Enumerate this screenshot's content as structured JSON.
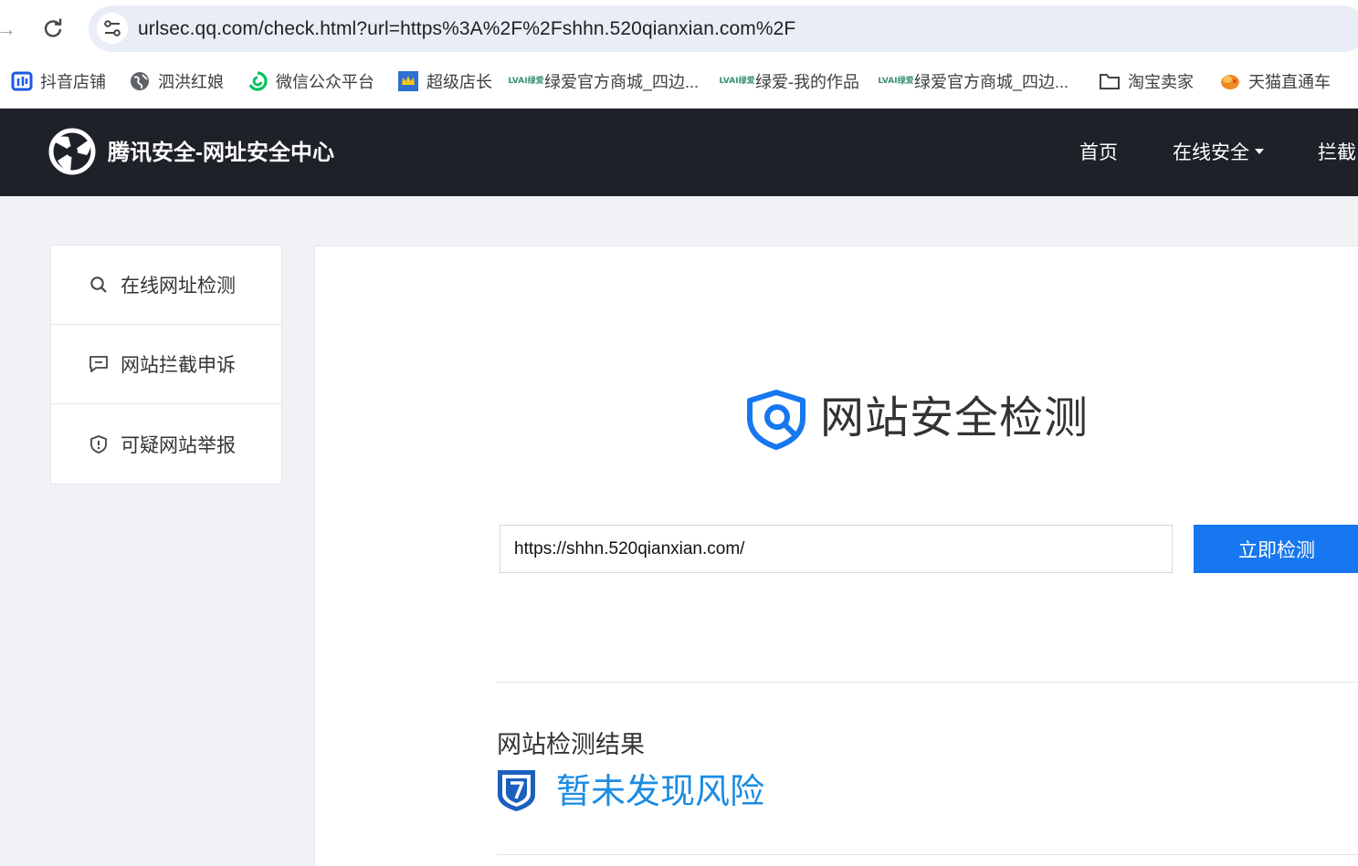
{
  "browser": {
    "url": "urlsec.qq.com/check.html?url=https%3A%2F%2Fshhn.520qianxian.com%2F",
    "bookmarks": [
      {
        "label": "抖音店铺",
        "icon": "douyin-shop-icon"
      },
      {
        "label": "泗洪红娘",
        "icon": "globe-icon"
      },
      {
        "label": "微信公众平台",
        "icon": "wechat-mp-icon"
      },
      {
        "label": "超级店长",
        "icon": "crown-icon"
      },
      {
        "label": "绿爱官方商城_四边...",
        "icon": "lvai-icon"
      },
      {
        "label": "绿爱-我的作品",
        "icon": "lvai-icon"
      },
      {
        "label": "绿爱官方商城_四边...",
        "icon": "lvai-icon"
      },
      {
        "label": "淘宝卖家",
        "icon": "folder-icon"
      },
      {
        "label": "天猫直通车",
        "icon": "tmall-icon"
      }
    ],
    "lvai_icon_text": {
      "top": "LVAI",
      "bottom": "绿爱"
    }
  },
  "header": {
    "title": "腾讯安全-网址安全中心",
    "nav": [
      {
        "label": "首页"
      },
      {
        "label": "在线安全"
      },
      {
        "label": "拦截"
      }
    ]
  },
  "sidebar": {
    "items": [
      {
        "label": "在线网址检测",
        "icon": "search-icon"
      },
      {
        "label": "网站拦截申诉",
        "icon": "message-icon"
      },
      {
        "label": "可疑网站举报",
        "icon": "shield-alert-icon"
      }
    ]
  },
  "main": {
    "hero_title": "网站安全检测",
    "input_value": "https://shhn.520qianxian.com/",
    "check_button": "立即检测",
    "result_heading": "网站检测结果",
    "result_text": "暂未发现风险"
  },
  "colors": {
    "header_bg": "#1e2128",
    "primary_button": "#1677f0",
    "result_text": "#1b8ce3",
    "page_bg": "#f1f2f5"
  }
}
